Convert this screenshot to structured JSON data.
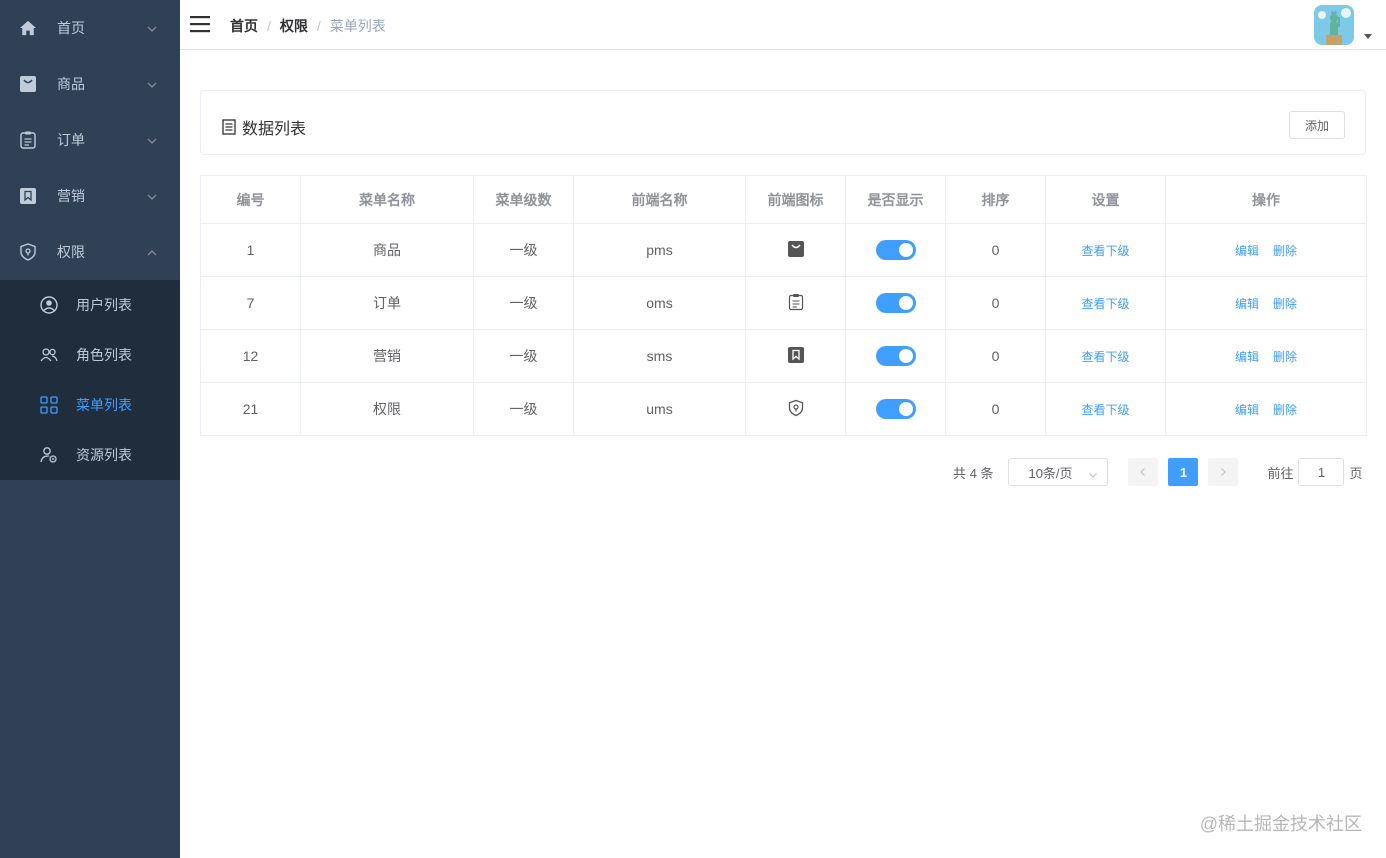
{
  "sidebar": {
    "items": [
      {
        "label": "首页",
        "icon": "home-icon",
        "expanded": false
      },
      {
        "label": "商品",
        "icon": "shopping-bag-icon",
        "expanded": false
      },
      {
        "label": "订单",
        "icon": "clipboard-icon",
        "expanded": false
      },
      {
        "label": "营销",
        "icon": "bookmark-icon",
        "expanded": false
      },
      {
        "label": "权限",
        "icon": "shield-icon",
        "expanded": true
      }
    ],
    "subitems": [
      {
        "label": "用户列表",
        "icon": "user-circle-icon",
        "active": false
      },
      {
        "label": "角色列表",
        "icon": "users-icon",
        "active": false
      },
      {
        "label": "菜单列表",
        "icon": "grid-icon",
        "active": true
      },
      {
        "label": "资源列表",
        "icon": "user-setting-icon",
        "active": false
      }
    ],
    "colors": {
      "background": "#304156",
      "submenu_background": "#1f2d3d",
      "text": "#bfcbd9",
      "active": "#409eff"
    }
  },
  "header": {
    "breadcrumb": [
      "首页",
      "权限",
      "菜单列表"
    ],
    "separator": "/"
  },
  "card": {
    "title": "数据列表",
    "add_label": "添加"
  },
  "table": {
    "headers": [
      "编号",
      "菜单名称",
      "菜单级数",
      "前端名称",
      "前端图标",
      "是否显示",
      "排序",
      "设置",
      "操作"
    ],
    "rows": [
      {
        "id": "1",
        "name": "商品",
        "level": "一级",
        "frontend_name": "pms",
        "icon": "shopping-bag-icon",
        "shown": true,
        "sort": "0",
        "setting": "查看下级",
        "edit": "编辑",
        "delete": "删除"
      },
      {
        "id": "7",
        "name": "订单",
        "level": "一级",
        "frontend_name": "oms",
        "icon": "clipboard-icon",
        "shown": true,
        "sort": "0",
        "setting": "查看下级",
        "edit": "编辑",
        "delete": "删除"
      },
      {
        "id": "12",
        "name": "营销",
        "level": "一级",
        "frontend_name": "sms",
        "icon": "bookmark-icon",
        "shown": true,
        "sort": "0",
        "setting": "查看下级",
        "edit": "编辑",
        "delete": "删除"
      },
      {
        "id": "21",
        "name": "权限",
        "level": "一级",
        "frontend_name": "ums",
        "icon": "shield-icon",
        "shown": true,
        "sort": "0",
        "setting": "查看下级",
        "edit": "编辑",
        "delete": "删除"
      }
    ]
  },
  "pagination": {
    "total": "共 4 条",
    "page_size": "10条/页",
    "current_page": "1",
    "goto_prefix": "前往",
    "goto_value": "1",
    "goto_suffix": "页"
  },
  "watermark": "@稀土掘金技术社区",
  "accent_color": "#409eff"
}
